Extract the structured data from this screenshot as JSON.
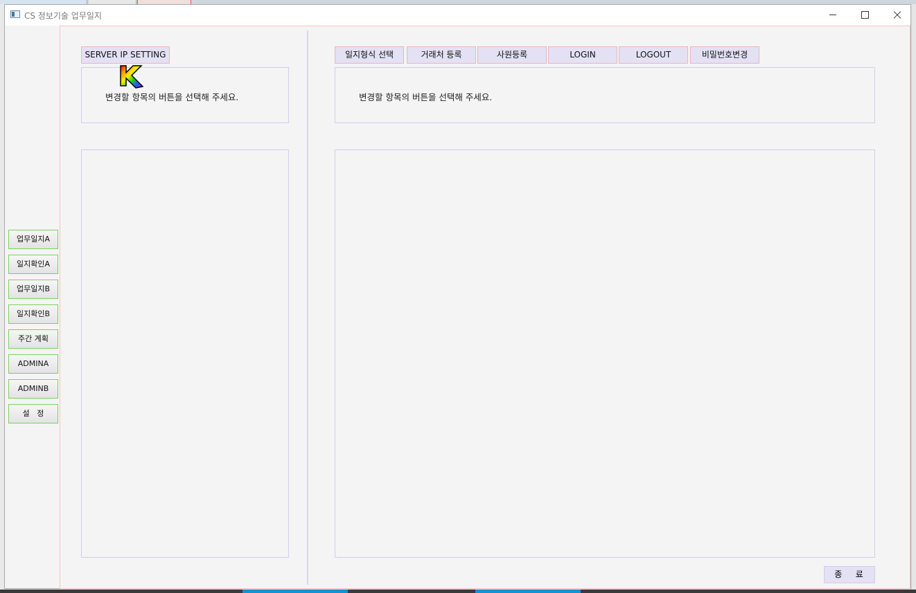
{
  "window": {
    "title": "CS 정보기술 업무일지"
  },
  "left_nav": {
    "items": [
      {
        "label": "업무일지A"
      },
      {
        "label": "일지확인A"
      },
      {
        "label": "업무일지B"
      },
      {
        "label": "일지확인B"
      },
      {
        "label": "주간 계획"
      },
      {
        "label": "ADMINA"
      },
      {
        "label": "ADMINB"
      },
      {
        "label": "설   정"
      }
    ]
  },
  "left_panel": {
    "button_label": "SERVER IP SETTING",
    "message": "변경할 항목의 버튼을 선택해 주세요."
  },
  "right_panel": {
    "tabs": [
      {
        "label": "일지형식 선택"
      },
      {
        "label": "거래처 등록"
      },
      {
        "label": "사원등록"
      },
      {
        "label": "LOGIN"
      },
      {
        "label": "LOGOUT"
      },
      {
        "label": "비밀번호변경"
      }
    ],
    "message": "변경할 항목의 버튼을 선택해 주세요."
  },
  "footer": {
    "exit_label": "종   료"
  },
  "colors": {
    "nav_border": "#7bd15a",
    "tab_bg": "#e3e1f3",
    "panel_border": "#cfcdee",
    "frame_border": "#f2c6c6"
  },
  "icons": {
    "overlay": "rainbow-k-icon"
  }
}
